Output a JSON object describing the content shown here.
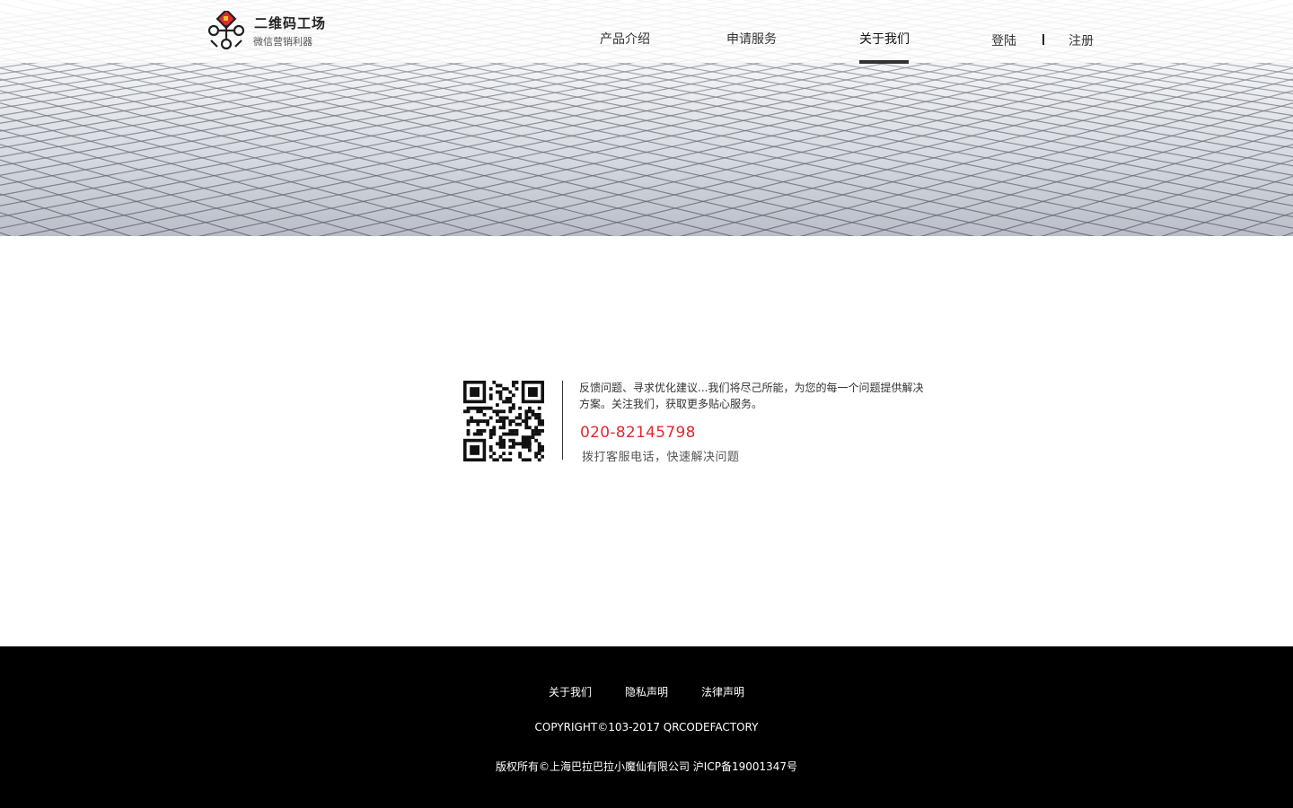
{
  "brand": {
    "name": "二维码工场",
    "slogan": "微信营销利器"
  },
  "nav": {
    "items": [
      {
        "label": "产品介绍"
      },
      {
        "label": "申请服务"
      },
      {
        "label": "关于我们"
      }
    ],
    "active_label": "关于我们"
  },
  "auth": {
    "login": "登陆",
    "register": "注册"
  },
  "contact": {
    "description": "反馈问题、寻求优化建议...我们将尽己所能，为您的每一个问题提供解决方案。关注我们，获取更多贴心服务。",
    "phone": "020-82145798",
    "tip": "拨打客服电话，快速解决问题"
  },
  "footer": {
    "links": [
      {
        "label": "关于我们"
      },
      {
        "label": "隐私声明"
      },
      {
        "label": "法律声明"
      }
    ],
    "copyright": "COPYRIGHT©103-2017 QRCODEFACTORY",
    "icp": "版权所有©上海巴拉巴拉小魔仙有限公司 沪ICP备19001347号"
  },
  "colors": {
    "accent_phone": "#e02a2f",
    "footer_bg": "#000000",
    "logo_red": "#e02a2f",
    "logo_gold": "#f0c020"
  },
  "icons": {
    "logo": "qr-diamond-logo-icon",
    "qr": "wechat-qr-code-icon"
  }
}
